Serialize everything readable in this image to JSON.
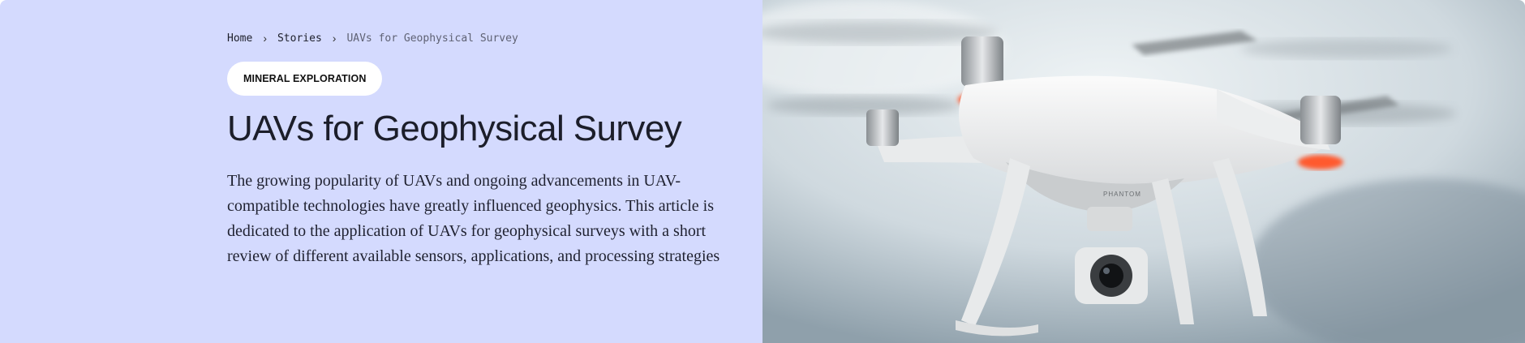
{
  "breadcrumb": {
    "items": [
      {
        "label": "Home"
      },
      {
        "label": "Stories"
      },
      {
        "label": "UAVs for Geophysical Survey"
      }
    ],
    "separator": "›"
  },
  "article": {
    "category_tag": "MINERAL EXPLORATION",
    "title": "UAVs for Geophysical Survey",
    "summary": "The growing popularity of UAVs and ongoing advancements in UAV-compatible technologies have greatly influenced geophysics. This article is dedicated to the application of UAVs for geophysical surveys with a short review of different available sensors, applications, and processing strategies"
  },
  "hero_image": {
    "subject": "drone-photo",
    "body_logo_text": "PHANTOM"
  },
  "colors": {
    "panel_background": "#d4dafe",
    "text_dark": "#1c1e2a",
    "breadcrumb_current": "#5f6274",
    "tag_background": "#ffffff",
    "drone_led": "#ff5a2e"
  }
}
